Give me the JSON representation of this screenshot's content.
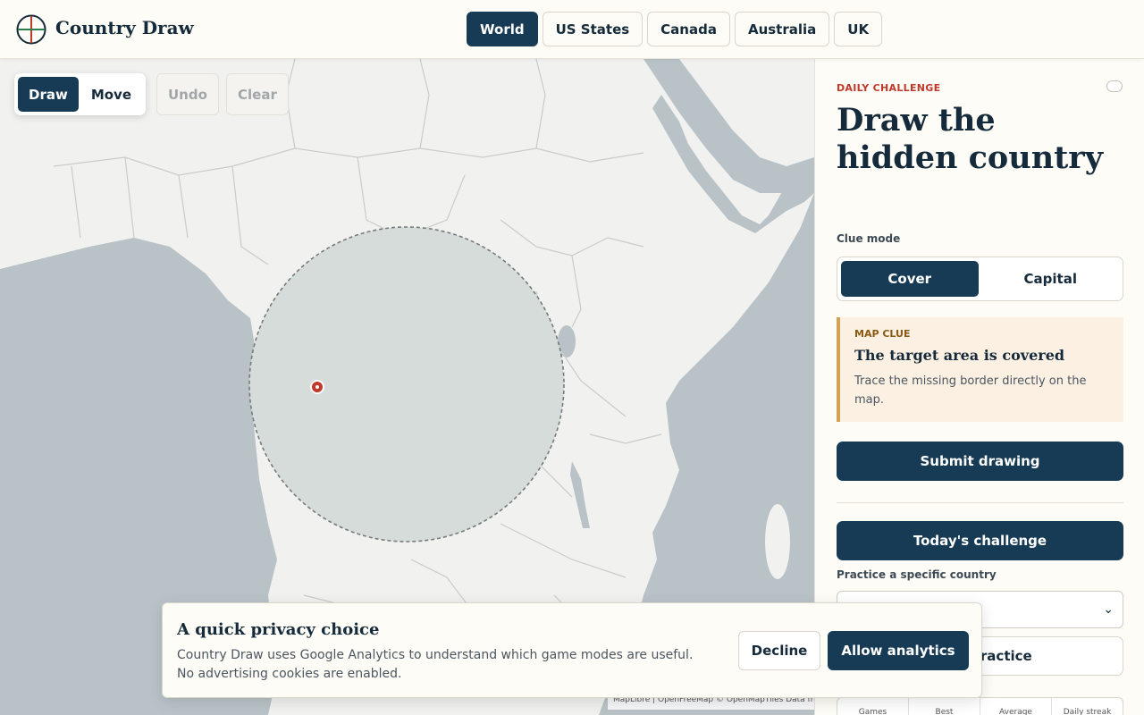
{
  "header": {
    "brand": "Country Draw",
    "tabs": [
      {
        "label": "World",
        "active": true
      },
      {
        "label": "US States"
      },
      {
        "label": "Canada"
      },
      {
        "label": "Australia"
      },
      {
        "label": "UK"
      }
    ]
  },
  "map": {
    "tools": {
      "draw": "Draw",
      "move": "Move",
      "undo": "Undo",
      "clear": "Clear"
    },
    "attribution": "MapLibre | OpenFreeMap © OpenMapTiles Data from OpenStreetMap",
    "colors": {
      "water": "#b9c3c7",
      "land": "#f1f1ef",
      "border": "#c9cccc",
      "cover": "#d6dcd9",
      "marker": "#c0392b"
    }
  },
  "panel": {
    "eyebrow": "DAILY CHALLENGE",
    "title": "Draw the hidden country",
    "clue_mode_label": "Clue mode",
    "clue_modes": [
      "Cover",
      "Capital"
    ],
    "active_clue_mode": "Cover",
    "clue": {
      "eyebrow": "MAP CLUE",
      "heading": "The target area is covered",
      "text": "Trace the missing border directly on the map."
    },
    "submit_label": "Submit drawing",
    "todays_challenge_label": "Today's challenge",
    "practice_label": "Practice a specific country",
    "practice_button": "Start practice",
    "stats": [
      "Games",
      "Best",
      "Average",
      "Daily streak"
    ]
  },
  "privacy": {
    "title": "A quick privacy choice",
    "text": "Country Draw uses Google Analytics to understand which game modes are useful. No advertising cookies are enabled.",
    "decline": "Decline",
    "allow": "Allow analytics"
  }
}
